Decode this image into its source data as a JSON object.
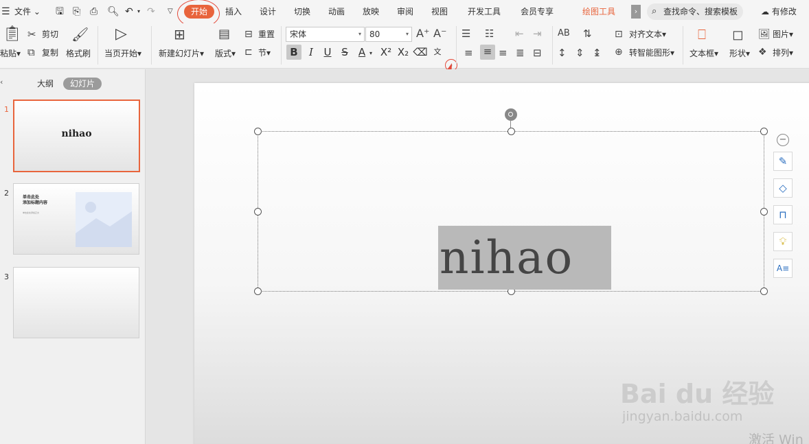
{
  "menu": {
    "file": "文件",
    "tabs": [
      "插入",
      "设计",
      "切换",
      "动画",
      "放映",
      "审阅",
      "视图",
      "开发工具",
      "会员专享"
    ],
    "active_tab": "开始",
    "drawing_tab": "绘图工具",
    "search": "查找命令、搜索模板",
    "modify": "有修改"
  },
  "ribbon": {
    "paste": "粘贴",
    "cut": "剪切",
    "copy": "复制",
    "format_painter": "格式刷",
    "play_from_current": "当页开始",
    "new_slide": "新建幻灯片",
    "layout": "版式",
    "reset": "重置",
    "section": "节",
    "font_name": "宋体",
    "font_size": "80",
    "align_text": "对齐文本",
    "smart_art": "转智能图形",
    "text_box": "文本框",
    "shape": "形状",
    "picture": "图片",
    "arrange": "排列"
  },
  "panel": {
    "outline_tab": "大纲",
    "slides_tab": "幻灯片",
    "slides": [
      {
        "num": "1",
        "text": "nihao"
      },
      {
        "num": "2",
        "title": "单击此处\n添加标题内容",
        "subtitle": "单击此处添加正文"
      },
      {
        "num": "3"
      }
    ]
  },
  "slide": {
    "text": "nihao"
  },
  "watermark": {
    "brand": "Bai du 经验",
    "url": "jingyan.baidu.com",
    "activate": "激活 Win"
  },
  "colors": {
    "accent": "#e8643c",
    "annotation": "#e44a3a"
  }
}
